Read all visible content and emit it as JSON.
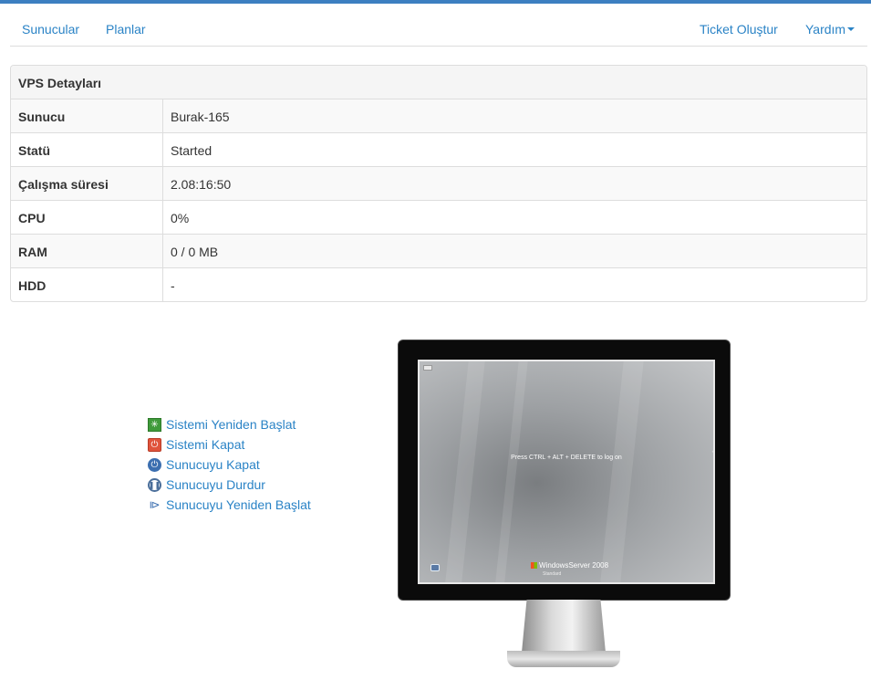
{
  "nav": {
    "left": [
      "Sunucular",
      "Planlar"
    ],
    "ticket": "Ticket Oluştur",
    "help": "Yardım"
  },
  "panel": {
    "title": "VPS Detayları",
    "rows": [
      {
        "label": "Sunucu",
        "value": "Burak-165"
      },
      {
        "label": "Statü",
        "value": "Started"
      },
      {
        "label": "Çalışma süresi",
        "value": "2.08:16:50"
      },
      {
        "label": "CPU",
        "value": "0%"
      },
      {
        "label": "RAM",
        "value": "0 / 0 MB"
      },
      {
        "label": "HDD",
        "value": "-"
      }
    ]
  },
  "actions": [
    {
      "label": "Sistemi Yeniden Başlat",
      "icon": "restart-system-icon"
    },
    {
      "label": "Sistemi Kapat",
      "icon": "shutdown-system-icon"
    },
    {
      "label": "Sunucuyu Kapat",
      "icon": "power-icon"
    },
    {
      "label": "Sunucuyu Durdur",
      "icon": "pause-icon"
    },
    {
      "label": "Sunucuyu Yeniden Başlat",
      "icon": "play-restart-icon"
    }
  ],
  "console": {
    "message": "Press CTRL + ALT + DELETE to log on",
    "brand": "WindowsServer 2008",
    "edition": "Standard"
  },
  "colors": {
    "accent": "#3c7fc1",
    "link": "#2a83c6"
  }
}
